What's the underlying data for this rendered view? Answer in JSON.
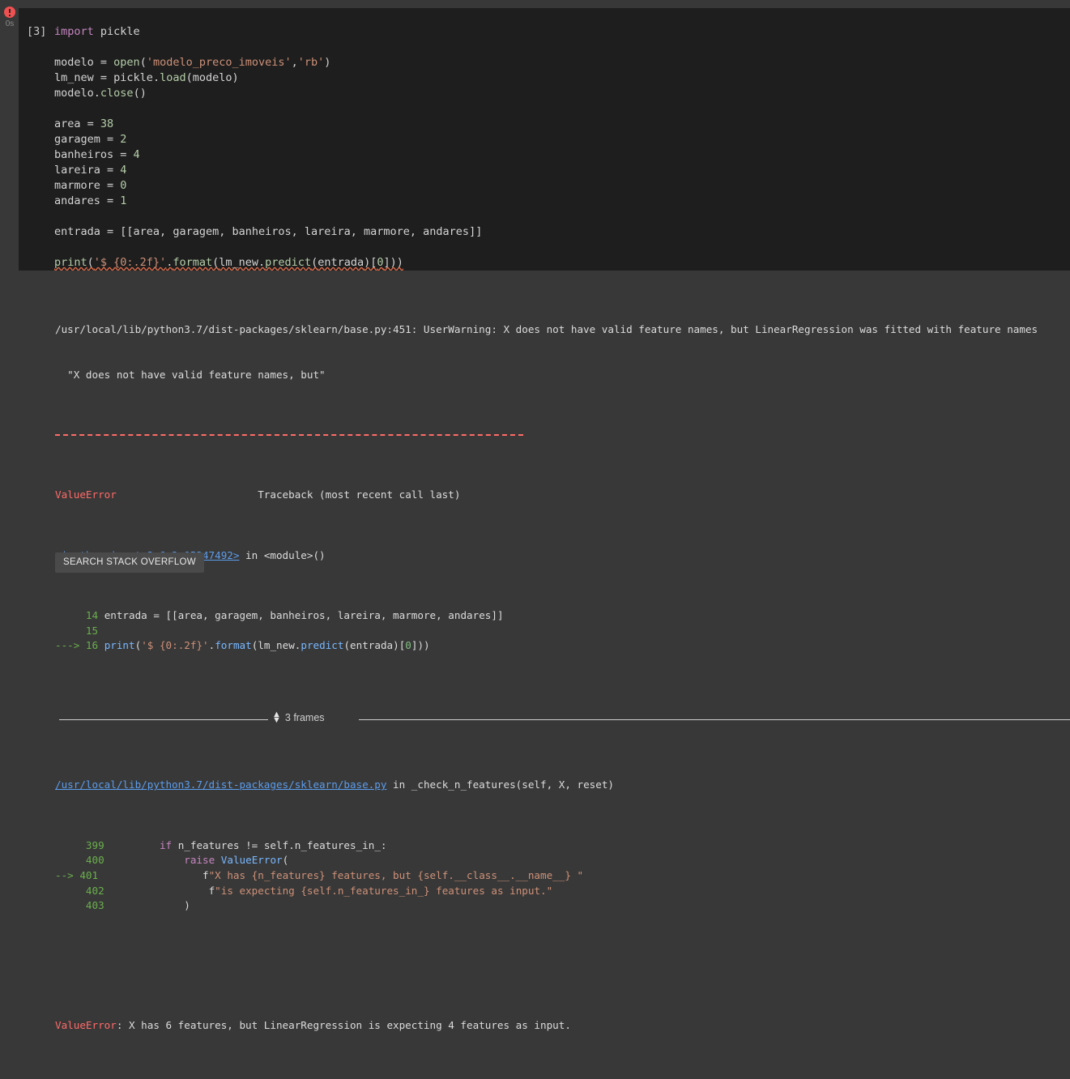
{
  "cell": {
    "prompt_label": "[3]",
    "exec_time": "0s",
    "status_icon": "error-circle-icon",
    "code_lines": [
      [
        {
          "t": "kw",
          "s": "import"
        },
        {
          "t": "plain",
          "s": " pickle"
        }
      ],
      [],
      [
        {
          "t": "plain",
          "s": "modelo "
        },
        {
          "t": "op",
          "s": "= "
        },
        {
          "t": "fn",
          "s": "open"
        },
        {
          "t": "op",
          "s": "("
        },
        {
          "t": "str",
          "s": "'modelo_preco_imoveis'"
        },
        {
          "t": "op",
          "s": ","
        },
        {
          "t": "str",
          "s": "'rb'"
        },
        {
          "t": "op",
          "s": ")"
        }
      ],
      [
        {
          "t": "plain",
          "s": "lm_new "
        },
        {
          "t": "op",
          "s": "= "
        },
        {
          "t": "plain",
          "s": "pickle"
        },
        {
          "t": "op",
          "s": "."
        },
        {
          "t": "fn",
          "s": "load"
        },
        {
          "t": "op",
          "s": "("
        },
        {
          "t": "plain",
          "s": "modelo"
        },
        {
          "t": "op",
          "s": ")"
        }
      ],
      [
        {
          "t": "plain",
          "s": "modelo"
        },
        {
          "t": "op",
          "s": "."
        },
        {
          "t": "fn",
          "s": "close"
        },
        {
          "t": "op",
          "s": "()"
        }
      ],
      [],
      [
        {
          "t": "plain",
          "s": "area "
        },
        {
          "t": "op",
          "s": "= "
        },
        {
          "t": "num",
          "s": "38"
        }
      ],
      [
        {
          "t": "plain",
          "s": "garagem "
        },
        {
          "t": "op",
          "s": "= "
        },
        {
          "t": "num",
          "s": "2"
        }
      ],
      [
        {
          "t": "plain",
          "s": "banheiros "
        },
        {
          "t": "op",
          "s": "= "
        },
        {
          "t": "num",
          "s": "4"
        }
      ],
      [
        {
          "t": "plain",
          "s": "lareira "
        },
        {
          "t": "op",
          "s": "= "
        },
        {
          "t": "num",
          "s": "4"
        }
      ],
      [
        {
          "t": "plain",
          "s": "marmore "
        },
        {
          "t": "op",
          "s": "= "
        },
        {
          "t": "num",
          "s": "0"
        }
      ],
      [
        {
          "t": "plain",
          "s": "andares "
        },
        {
          "t": "op",
          "s": "= "
        },
        {
          "t": "num",
          "s": "1"
        }
      ],
      [],
      [
        {
          "t": "plain",
          "s": "entrada "
        },
        {
          "t": "op",
          "s": "= [["
        },
        {
          "t": "plain",
          "s": "area, garagem, banheiros, lareira, marmore, andares"
        },
        {
          "t": "op",
          "s": "]]"
        }
      ],
      [],
      [
        {
          "t": "sq-fn",
          "s": "print"
        },
        {
          "t": "sq-op",
          "s": "("
        },
        {
          "t": "sq-str",
          "s": "'$ {0:.2f}'"
        },
        {
          "t": "sq-op",
          "s": "."
        },
        {
          "t": "sq-fn",
          "s": "format"
        },
        {
          "t": "sq-op",
          "s": "("
        },
        {
          "t": "sq-plain",
          "s": "lm_new"
        },
        {
          "t": "sq-op",
          "s": "."
        },
        {
          "t": "sq-fn",
          "s": "predict"
        },
        {
          "t": "sq-op",
          "s": "("
        },
        {
          "t": "sq-plain",
          "s": "entrada"
        },
        {
          "t": "sq-op",
          "s": ")["
        },
        {
          "t": "sq-num",
          "s": "0"
        },
        {
          "t": "sq-op",
          "s": "]))"
        }
      ]
    ]
  },
  "output": {
    "warning_line_1": "/usr/local/lib/python3.7/dist-packages/sklearn/base.py:451: UserWarning: X does not have valid feature names, but LinearRegression was fitted with feature names",
    "warning_line_2": "  \"X does not have valid feature names, but\"",
    "traceback_header_error": "ValueError",
    "traceback_header_right": "Traceback (most recent call last)",
    "frame1_link": "<ipython-input-3-6a3c05247492>",
    "frame1_in": " in ",
    "frame1_scope": "<module>()",
    "frame1_code": [
      {
        "arrow": "",
        "num": "14",
        "code": "entrada = [[area, garagem, banheiros, lareira, marmore, andares]]"
      },
      {
        "arrow": "",
        "num": "15",
        "code": ""
      },
      {
        "arrow": "--->",
        "num": "16",
        "code": "print('$ {0:.2f}'.format(lm_new.predict(entrada)[0]))"
      }
    ],
    "frames_toggle_label": "3 frames",
    "frames_toggle_icon": "expand-collapse-icon",
    "frame2_link": "/usr/local/lib/python3.7/dist-packages/sklearn/base.py",
    "frame2_in": " in ",
    "frame2_scope": "_check_n_features(self, X, reset)",
    "frame2_code": [
      {
        "arrow": "",
        "num": "399",
        "code": "        if n_features != self.n_features_in_:"
      },
      {
        "arrow": "",
        "num": "400",
        "code": "            raise ValueError("
      },
      {
        "arrow": "-->",
        "num": "401",
        "code": "                f\"X has {n_features} features, but {self.__class__.__name__} \""
      },
      {
        "arrow": "",
        "num": "402",
        "code": "                f\"is expecting {self.n_features_in_} features as input.\""
      },
      {
        "arrow": "",
        "num": "403",
        "code": "            )"
      }
    ],
    "final_error_name": "ValueError",
    "final_error_message": ": X has 6 features, but LinearRegression is expecting 4 features as input.",
    "search_button_label": "SEARCH STACK OVERFLOW"
  },
  "colors": {
    "cell_background": "#1e1e1e",
    "output_background": "#383838",
    "error_red": "#ff6b68",
    "link_blue": "#5c9ded",
    "line_number_green": "#6ab04c",
    "keyword_purple": "#c586c0",
    "string_orange": "#ce9178",
    "status_dot_red": "#f05050"
  }
}
